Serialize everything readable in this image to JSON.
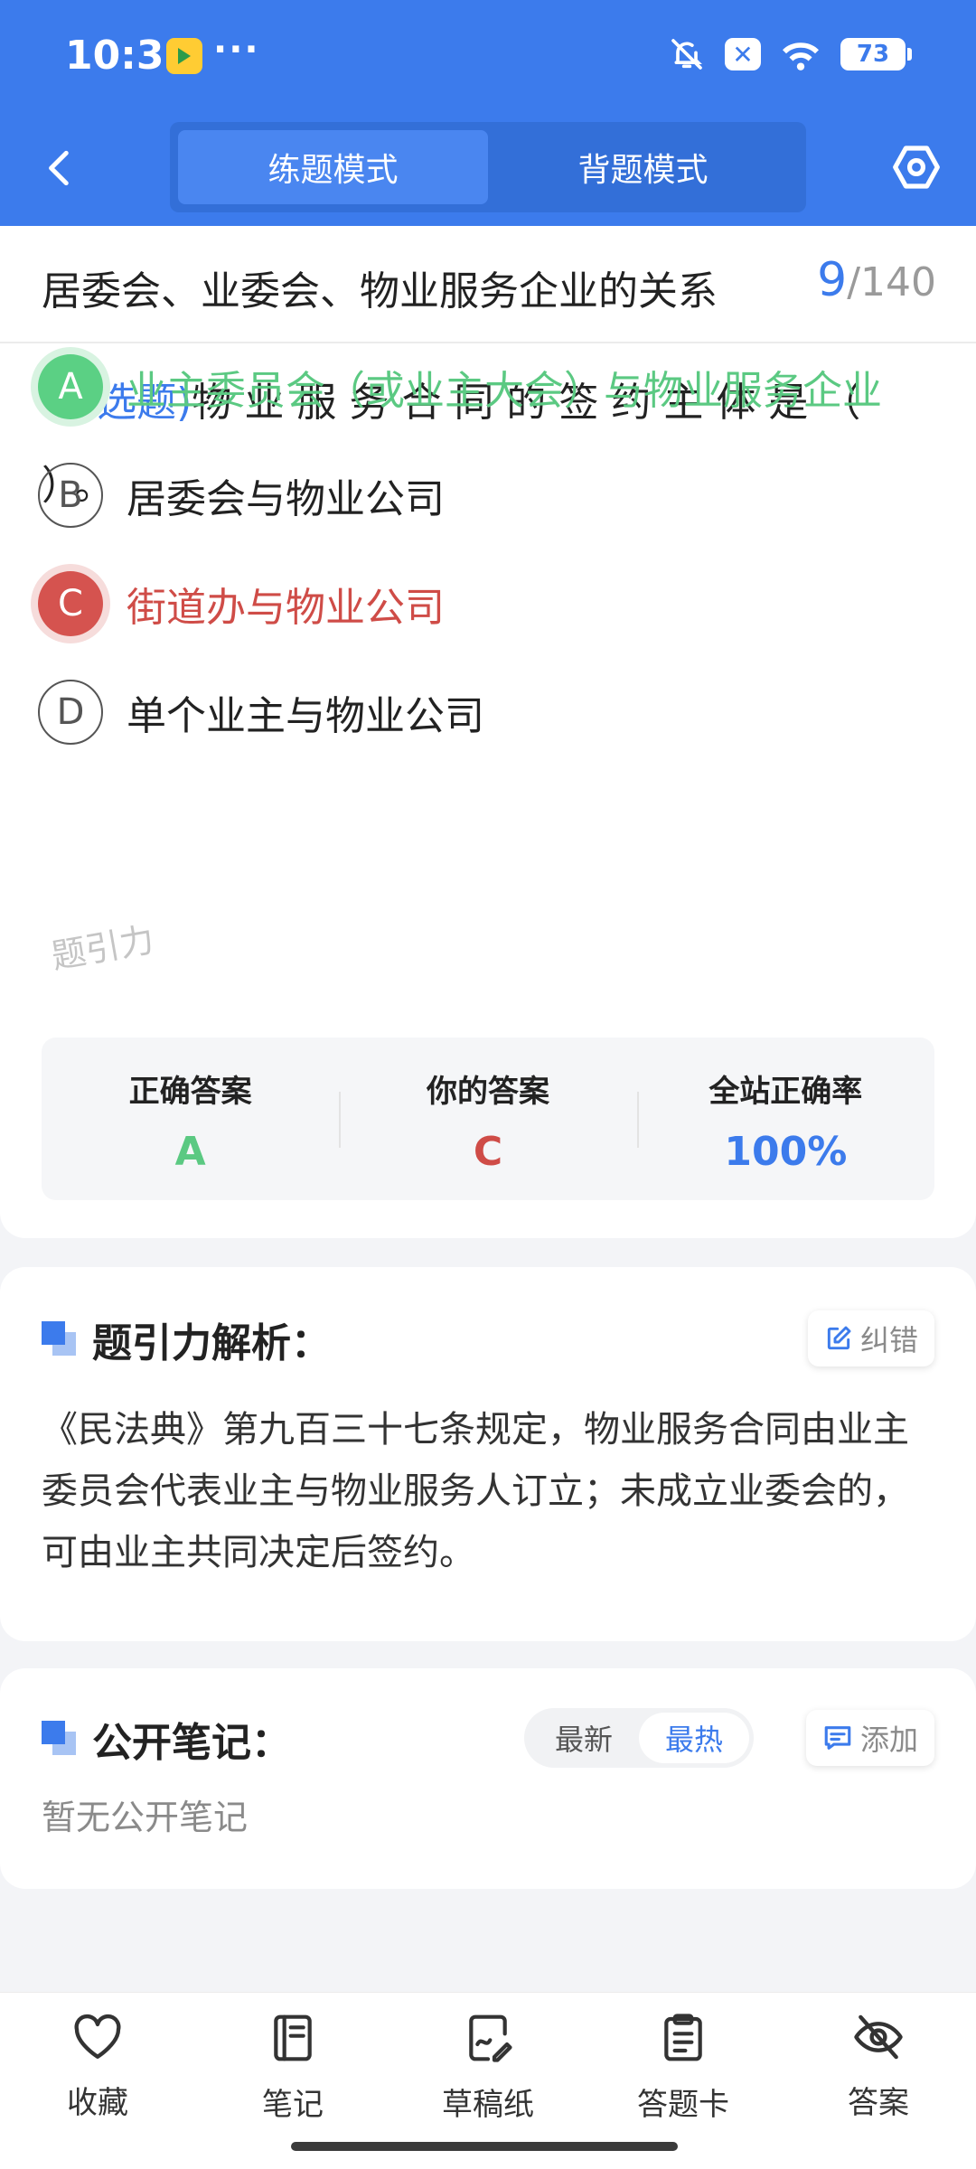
{
  "status": {
    "time": "10:31",
    "dots": "···",
    "battery": "73",
    "x_badge": "✕"
  },
  "nav": {
    "tabs": [
      {
        "label": "练题模式",
        "active": true
      },
      {
        "label": "背题模式",
        "active": false
      }
    ]
  },
  "question": {
    "title": "居委会、业委会、物业服务企业的关系",
    "current": "9",
    "total": "/140",
    "type_label": "(单选题)",
    "text": "物业服务合同的签约主体是（  ）。",
    "options": [
      {
        "letter": "A",
        "text": "业主委员会（或业主大会）与物业服务企业",
        "state": "correct"
      },
      {
        "letter": "B",
        "text": "居委会与物业公司",
        "state": "normal"
      },
      {
        "letter": "C",
        "text": "街道办与物业公司",
        "state": "wrong"
      },
      {
        "letter": "D",
        "text": "单个业主与物业公司",
        "state": "normal"
      }
    ]
  },
  "answer_panel": {
    "correct_label": "正确答案",
    "correct_value": "A",
    "yours_label": "你的答案",
    "yours_value": "C",
    "rate_label": "全站正确率",
    "rate_value": "100%",
    "watermark": "题引力"
  },
  "analysis": {
    "title": "题引力解析：",
    "correction_label": "纠错",
    "text": "《民法典》第九百三十七条规定，物业服务合同由业主委员会代表业主与物业服务人订立；未成立业委会的，可由业主共同决定后签约。"
  },
  "notes": {
    "title": "公开笔记：",
    "sort_tabs": [
      {
        "label": "最新",
        "active": false
      },
      {
        "label": "最热",
        "active": true
      }
    ],
    "add_label": "添加",
    "empty_text": "暂无公开笔记"
  },
  "bottom_bar": {
    "items": [
      {
        "label": "收藏",
        "icon": "heart-icon"
      },
      {
        "label": "笔记",
        "icon": "notebook-icon"
      },
      {
        "label": "草稿纸",
        "icon": "draft-paper-icon"
      },
      {
        "label": "答题卡",
        "icon": "answer-sheet-icon"
      },
      {
        "label": "答案",
        "icon": "eye-off-icon"
      }
    ]
  },
  "colors": {
    "primary": "#3c7bec",
    "correct": "#5bc982",
    "wrong": "#cf4c47",
    "muted": "#8a8a8a"
  }
}
